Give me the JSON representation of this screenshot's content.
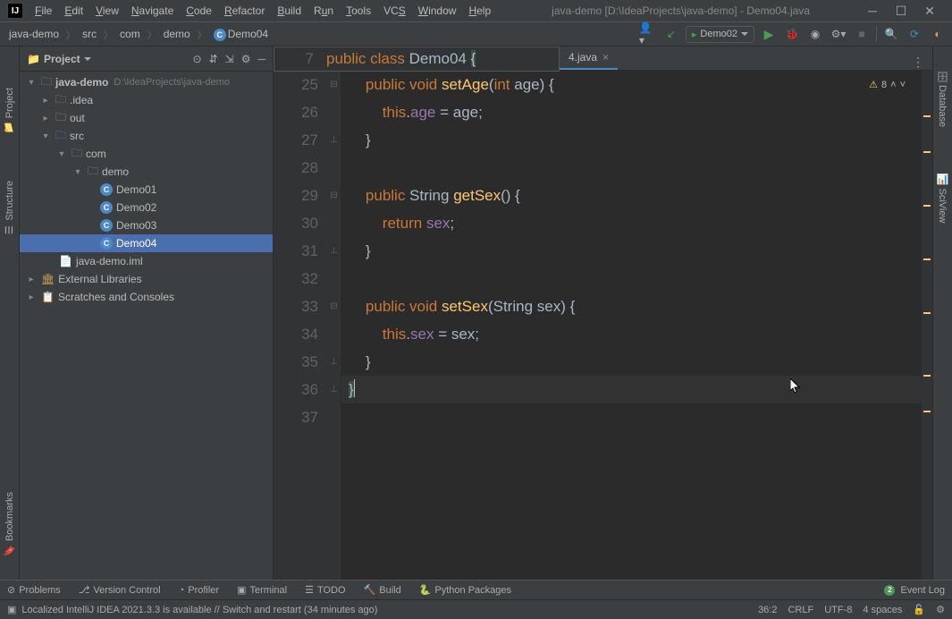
{
  "title": "java-demo [D:\\IdeaProjects\\java-demo] - Demo04.java",
  "menu": {
    "file": "File",
    "edit": "Edit",
    "view": "View",
    "navigate": "Navigate",
    "code": "Code",
    "refactor": "Refactor",
    "build": "Build",
    "run": "Run",
    "tools": "Tools",
    "vcs": "VCS",
    "window": "Window",
    "help": "Help"
  },
  "breadcrumb": {
    "project": "java-demo",
    "src": "src",
    "com": "com",
    "demo": "demo",
    "cls": "Demo04"
  },
  "runconfig": "Demo02",
  "sidebar": {
    "title": "Project",
    "project": {
      "name": "java-demo",
      "path": "D:\\IdeaProjects\\java-demo"
    },
    "idea": ".idea",
    "out": "out",
    "src": "src",
    "com": "com",
    "demo": "demo",
    "d1": "Demo01",
    "d2": "Demo02",
    "d3": "Demo03",
    "d4": "Demo04",
    "iml": "java-demo.iml",
    "ext": "External Libraries",
    "scratch": "Scratches and Consoles"
  },
  "tabs": {
    "t1": "4.java"
  },
  "code": {
    "float_ln": "7",
    "float_code": "public class Demo04 {",
    "l25": {
      "n": "25",
      "txt": "        public void setAge(int age) {"
    },
    "l26": {
      "n": "26",
      "txt": "            this.age = age;"
    },
    "l27": {
      "n": "27",
      "txt": "        }"
    },
    "l28": {
      "n": "28",
      "txt": ""
    },
    "l29": {
      "n": "29",
      "txt": "        public String getSex() {"
    },
    "l30": {
      "n": "30",
      "txt": "            return sex;"
    },
    "l31": {
      "n": "31",
      "txt": "        }"
    },
    "l32": {
      "n": "32",
      "txt": ""
    },
    "l33": {
      "n": "33",
      "txt": "        public void setSex(String sex) {"
    },
    "l34": {
      "n": "34",
      "txt": "            this.sex = sex;"
    },
    "l35": {
      "n": "35",
      "txt": "        }"
    },
    "l36": {
      "n": "36",
      "txt": "}"
    },
    "l37": {
      "n": "37",
      "txt": ""
    }
  },
  "inspection": {
    "count": "8"
  },
  "bottom": {
    "problems": "Problems",
    "vcs": "Version Control",
    "profiler": "Profiler",
    "terminal": "Terminal",
    "todo": "TODO",
    "build": "Build",
    "python": "Python Packages",
    "eventlog": "Event Log"
  },
  "status": {
    "msg": "Localized IntelliJ IDEA 2021.3.3 is available // Switch and restart (34 minutes ago)",
    "pos": "36:2",
    "le": "CRLF",
    "enc": "UTF-8",
    "indent": "4 spaces"
  },
  "gutters": {
    "project": "Project",
    "structure": "Structure",
    "bookmarks": "Bookmarks",
    "database": "Database",
    "sciview": "SciView"
  }
}
